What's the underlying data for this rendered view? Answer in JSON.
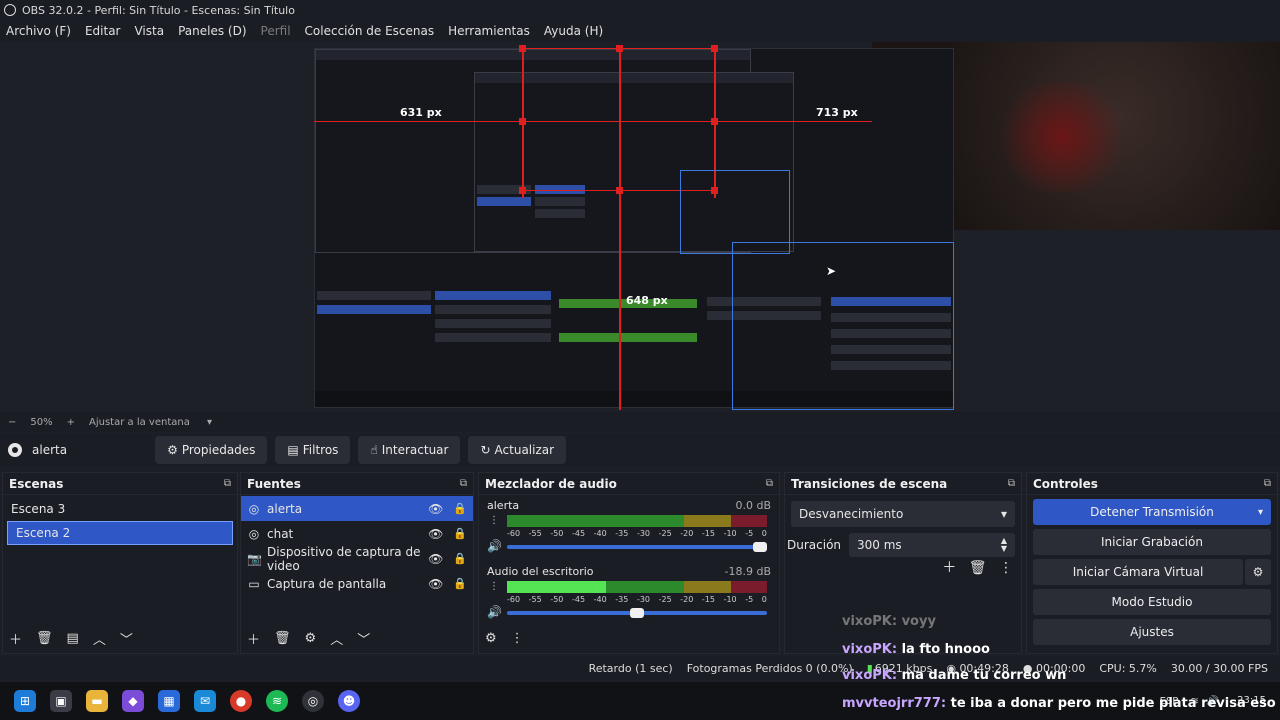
{
  "window": {
    "title": "OBS 32.0.2 - Perfil: Sin Título - Escenas: Sin Título"
  },
  "menu": [
    {
      "label": "Archivo (F)",
      "disabled": false
    },
    {
      "label": "Editar",
      "disabled": false
    },
    {
      "label": "Vista",
      "disabled": false
    },
    {
      "label": "Paneles (D)",
      "disabled": false
    },
    {
      "label": "Perfil",
      "disabled": true
    },
    {
      "label": "Colección de Escenas",
      "disabled": false
    },
    {
      "label": "Herramientas",
      "disabled": false
    },
    {
      "label": "Ayuda (H)",
      "disabled": false
    }
  ],
  "preview": {
    "measure_left": "631 px",
    "measure_right": "713 px",
    "measure_center": "648 px"
  },
  "zoom": {
    "minus": "−",
    "value": "50%",
    "plus": "+",
    "fit_label": "Ajustar a la ventana"
  },
  "source_toolbar": {
    "selected_source": "alerta",
    "properties": "Propiedades",
    "filters": "Filtros",
    "interact": "Interactuar",
    "refresh": "Actualizar"
  },
  "scenes": {
    "title": "Escenas",
    "items": [
      {
        "label": "Escena 3",
        "selected": false
      },
      {
        "label": "Escena 2",
        "selected": true
      }
    ]
  },
  "sources": {
    "title": "Fuentes",
    "items": [
      {
        "label": "alerta",
        "icon": "globe-icon",
        "selected": true
      },
      {
        "label": "chat",
        "icon": "globe-icon",
        "selected": false
      },
      {
        "label": "Dispositivo de captura de video",
        "icon": "camera-icon",
        "selected": false
      },
      {
        "label": "Captura de pantalla",
        "icon": "monitor-icon",
        "selected": false
      }
    ]
  },
  "mixer": {
    "title": "Mezclador de audio",
    "ticks": [
      "-60",
      "-55",
      "-50",
      "-45",
      "-40",
      "-35",
      "-30",
      "-25",
      "-20",
      "-15",
      "-10",
      "-5",
      "0"
    ],
    "channels": [
      {
        "name": "alerta",
        "db": "0.0 dB",
        "level": 0.0,
        "fader": 1.0
      },
      {
        "name": "Audio del escritorio",
        "db": "-18.9 dB",
        "level": 0.38,
        "fader": 0.5
      }
    ]
  },
  "transitions": {
    "title": "Transiciones de escena",
    "selected": "Desvanecimiento",
    "duration_label": "Duración",
    "duration_value": "300 ms"
  },
  "controls": {
    "title": "Controles",
    "stop_stream": "Detener Transmisión",
    "start_recording": "Iniciar Grabación",
    "start_virtual_cam": "Iniciar Cámara Virtual",
    "studio_mode": "Modo Estudio",
    "settings": "Ajustes"
  },
  "status": {
    "delay": "Retardo (1 sec)",
    "dropped": "Fotogramas Perdidos 0 (0.0%)",
    "bitrate": "6921 kbps",
    "stream_time": "00:49:28",
    "rec_time": "00:00:00",
    "cpu": "CPU: 5.7%",
    "fps": "30.00 / 30.00 FPS"
  },
  "taskbar": {
    "lang": "ESP",
    "time": "23:15"
  },
  "chat_overlay": [
    {
      "user": "vixoPK:",
      "msg": "voyy",
      "faded": true
    },
    {
      "user": "vixoPK:",
      "msg": "la fto hnooo",
      "faded": false
    },
    {
      "user": "vixoPK:",
      "msg": "ma dame tu correo wn",
      "faded": false
    },
    {
      "user": "mvvteojrr777:",
      "msg": "te iba a donar pero me pide plata revisa eso bro",
      "faded": false
    }
  ]
}
